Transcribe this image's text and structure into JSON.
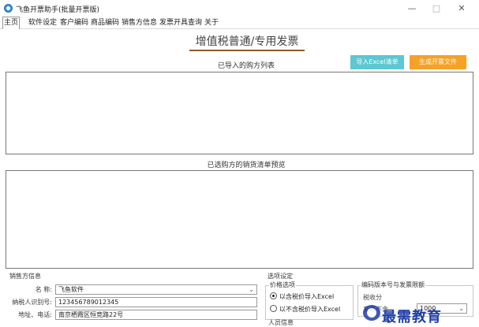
{
  "window": {
    "title": "飞鱼开票助手(批量开票版)",
    "minimize_glyph": "—",
    "maximize_glyph": "□",
    "close_glyph": "✕"
  },
  "menu": {
    "items": [
      "主页",
      "软件设定",
      "客户编码",
      "商品编码",
      "销售方信息",
      "发票开具查询",
      "关于"
    ]
  },
  "header": {
    "title": "增值税普通/专用发票"
  },
  "buttons": {
    "import_excel": "导入Excel清单",
    "generate_file": "生成开票文件"
  },
  "sections": {
    "buyer_list": "已导入的购方列表",
    "sales_list_preview": "已选购方的销货清单预览"
  },
  "seller": {
    "group_label": "销售方信息",
    "name_label": "名  称:",
    "name_value": "飞鱼软件",
    "taxid_label": "纳税人识别号:",
    "taxid_value": "123456789012345",
    "address_label": "地址、电话:",
    "address_value": "南京栖霞区恒竞路22号"
  },
  "options": {
    "group_label": "选项设定",
    "price_group_label": "价格选项",
    "radio_incl": "以含税价导入Excel",
    "radio_excl": "以不含税价导入Excel",
    "radio_selected": "incl",
    "person_group_label": "人员信息",
    "coding_group_label": "编码版本号与发票限额",
    "tax_code_label": "税收分",
    "invoice_limit_label": "发票不含",
    "invoice_limit_value": "1000"
  },
  "watermark": {
    "text": "最需教育"
  },
  "colors": {
    "teal_button": "#5bc8d2",
    "orange_button": "#f7a126",
    "title_underline": "#8b5a2b",
    "watermark": "#1f3fa8"
  }
}
